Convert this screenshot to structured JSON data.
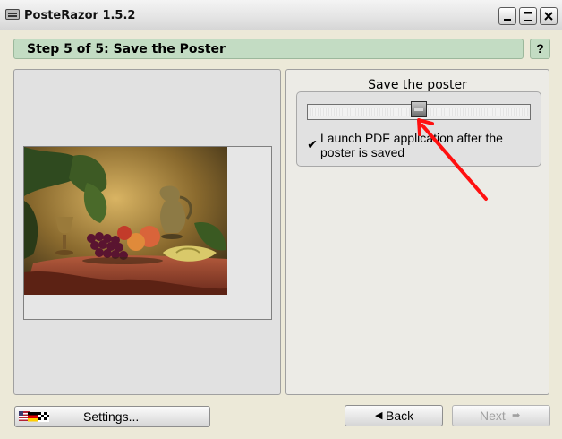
{
  "window": {
    "title": "PosteRazor 1.5.2"
  },
  "step": {
    "title": "Step 5 of 5: Save the Poster",
    "help_label": "?"
  },
  "save_panel": {
    "title": "Save the poster",
    "progress_fraction": 0.5,
    "launch_pdf": {
      "checked": true,
      "label": "Launch PDF application after the poster is saved"
    }
  },
  "buttons": {
    "settings": "Settings...",
    "back": "Back",
    "next": "Next"
  },
  "icons": {
    "app": "app-icon",
    "minimize": "minimize-icon",
    "maximize": "maximize-icon",
    "close": "close-icon",
    "flags": "language-flags-icon",
    "back": "arrow-left-icon",
    "next": "arrow-right-icon",
    "check": "checkmark-icon"
  },
  "colors": {
    "step_bar": "#c3dcc3",
    "panel": "#e1e1e1",
    "annotation": "#ff1010",
    "disabled_text": "#a0a0a0"
  }
}
